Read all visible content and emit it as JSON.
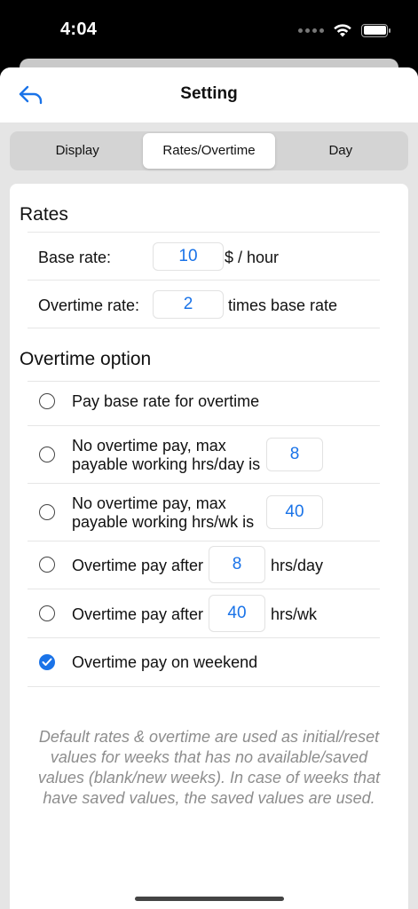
{
  "status": {
    "time": "4:04"
  },
  "nav": {
    "title": "Setting",
    "back_icon": "back-arrow-icon"
  },
  "tabs": [
    {
      "label": "Display",
      "active": false
    },
    {
      "label": "Rates/Overtime",
      "active": true
    },
    {
      "label": "Day",
      "active": false
    }
  ],
  "rates": {
    "title": "Rates",
    "base_label": "Base rate:",
    "base_value": "10",
    "base_unit": "$ / hour",
    "overtime_label": "Overtime rate:",
    "overtime_value": "2",
    "overtime_unit": "times base rate"
  },
  "overtime": {
    "title": "Overtime option",
    "options": [
      {
        "line1": "Pay base rate for overtime",
        "checked": false
      },
      {
        "line1": "No overtime pay, max",
        "line2": "payable working hrs/day is",
        "value": "8",
        "checked": false
      },
      {
        "line1": "No overtime pay, max",
        "line2": "payable working hrs/wk is",
        "value": "40",
        "checked": false
      },
      {
        "line1": "Overtime pay after",
        "value": "8",
        "unit": "hrs/day",
        "checked": false
      },
      {
        "line1": "Overtime pay after",
        "value": "40",
        "unit": "hrs/wk",
        "checked": false
      },
      {
        "line1": "Overtime pay on weekend",
        "checked": true
      }
    ]
  },
  "footnote": "Default rates & overtime are used as initial/reset values for weeks that has no available/saved values (blank/new weeks). In case of weeks that have saved values, the saved values are used.",
  "colors": {
    "accent": "#1a73e8"
  }
}
